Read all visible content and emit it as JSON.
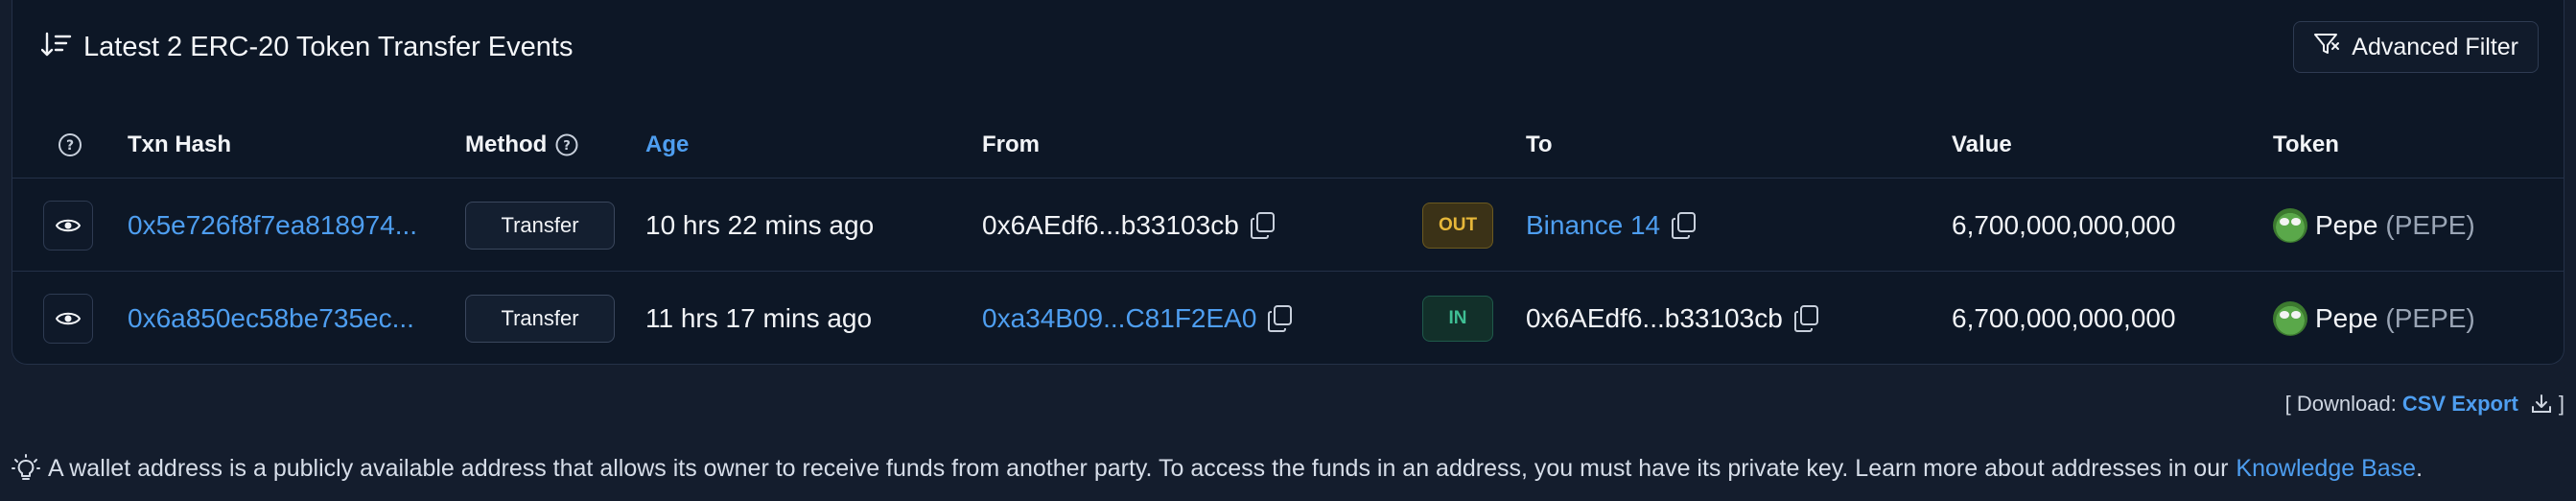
{
  "header": {
    "title": "Latest 2 ERC-20 Token Transfer Events",
    "advanced_filter_label": "Advanced Filter"
  },
  "table": {
    "columns": {
      "txn_hash": "Txn Hash",
      "method": "Method",
      "age": "Age",
      "from": "From",
      "to": "To",
      "value": "Value",
      "token": "Token"
    },
    "rows": [
      {
        "txn_hash": "0x5e726f8f7ea818974...",
        "method": "Transfer",
        "age": "10 hrs 22 mins ago",
        "from": "0x6AEdf6...b33103cb",
        "direction": "OUT",
        "to": "Binance 14",
        "value": "6,700,000,000,000",
        "token_name": "Pepe",
        "token_symbol": "(PEPE)"
      },
      {
        "txn_hash": "0x6a850ec58be735ec...",
        "method": "Transfer",
        "age": "11 hrs 17 mins ago",
        "from": "0xa34B09...C81F2EA0",
        "direction": "IN",
        "to": "0x6AEdf6...b33103cb",
        "value": "6,700,000,000,000",
        "token_name": "Pepe",
        "token_symbol": "(PEPE)"
      }
    ]
  },
  "download": {
    "prefix": "[ Download:",
    "csv_label": "CSV Export",
    "suffix": "]"
  },
  "footer": {
    "text": "A wallet address is a publicly available address that allows its owner to receive funds from another party. To access the funds in an address, you must have its private key. Learn more about addresses in our",
    "link": "Knowledge Base",
    "end": "."
  },
  "colors": {
    "background": "#141d2d",
    "card": "#0d1726",
    "link": "#4e9ef0",
    "out_badge": "#e6b739",
    "in_badge": "#3fbf94"
  }
}
